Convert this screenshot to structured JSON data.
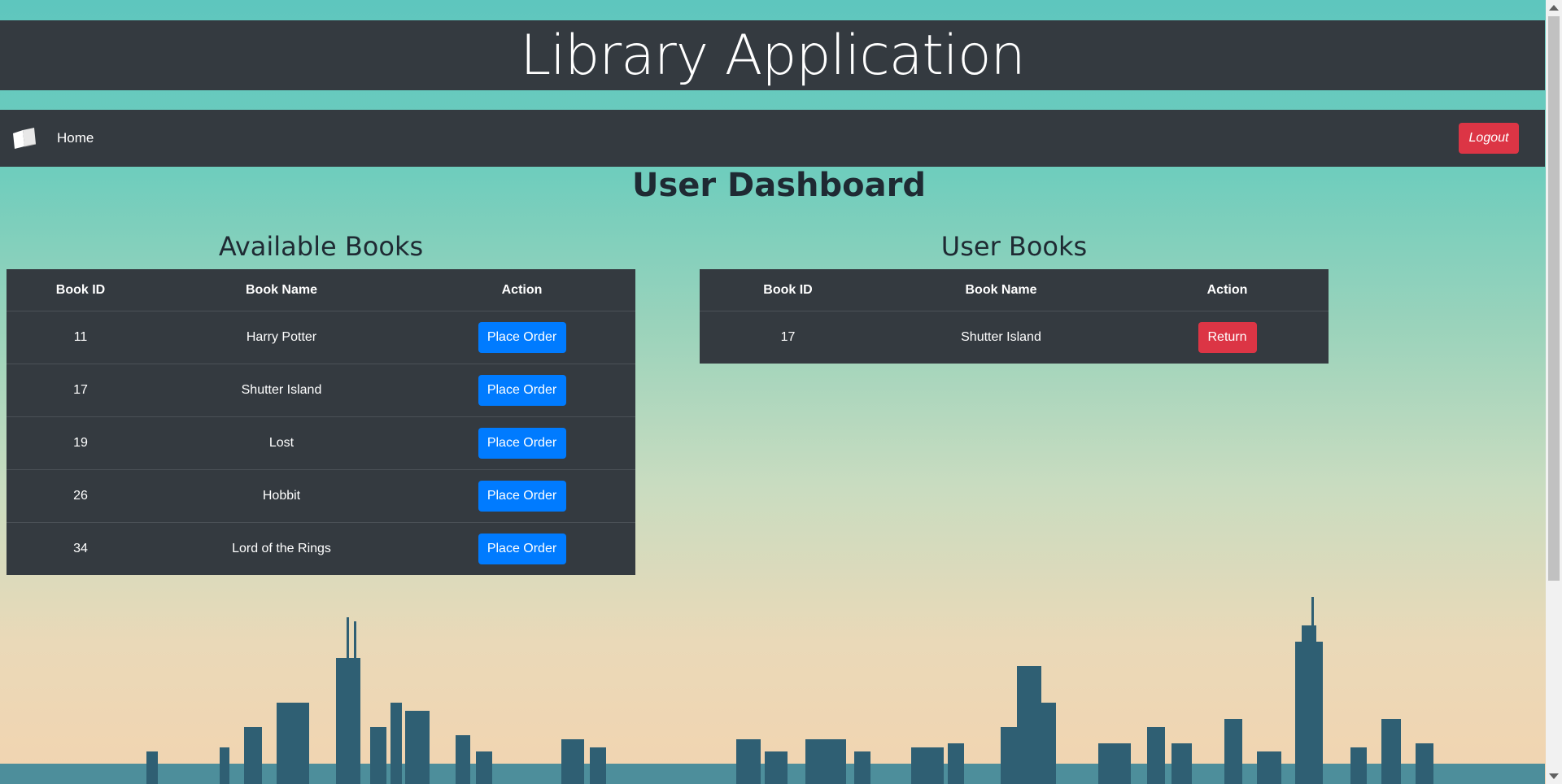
{
  "app": {
    "title": "Library Application"
  },
  "nav": {
    "home_label": "Home",
    "logout_label": "Logout"
  },
  "page": {
    "heading": "User Dashboard"
  },
  "available_books": {
    "title": "Available Books",
    "columns": [
      "Book ID",
      "Book Name",
      "Action"
    ],
    "rows": [
      {
        "id": "11",
        "name": "Harry Potter",
        "action": "Place Order"
      },
      {
        "id": "17",
        "name": "Shutter Island",
        "action": "Place Order"
      },
      {
        "id": "19",
        "name": "Lost",
        "action": "Place Order"
      },
      {
        "id": "26",
        "name": "Hobbit",
        "action": "Place Order"
      },
      {
        "id": "34",
        "name": "Lord of the Rings",
        "action": "Place Order"
      }
    ]
  },
  "user_books": {
    "title": "User Books",
    "columns": [
      "Book ID",
      "Book Name",
      "Action"
    ],
    "rows": [
      {
        "id": "17",
        "name": "Shutter Island",
        "action": "Return"
      }
    ]
  },
  "colors": {
    "header_bg": "#343a40",
    "primary": "#007bff",
    "danger": "#dc3545"
  },
  "icons": {
    "brand": "open-book-icon"
  }
}
